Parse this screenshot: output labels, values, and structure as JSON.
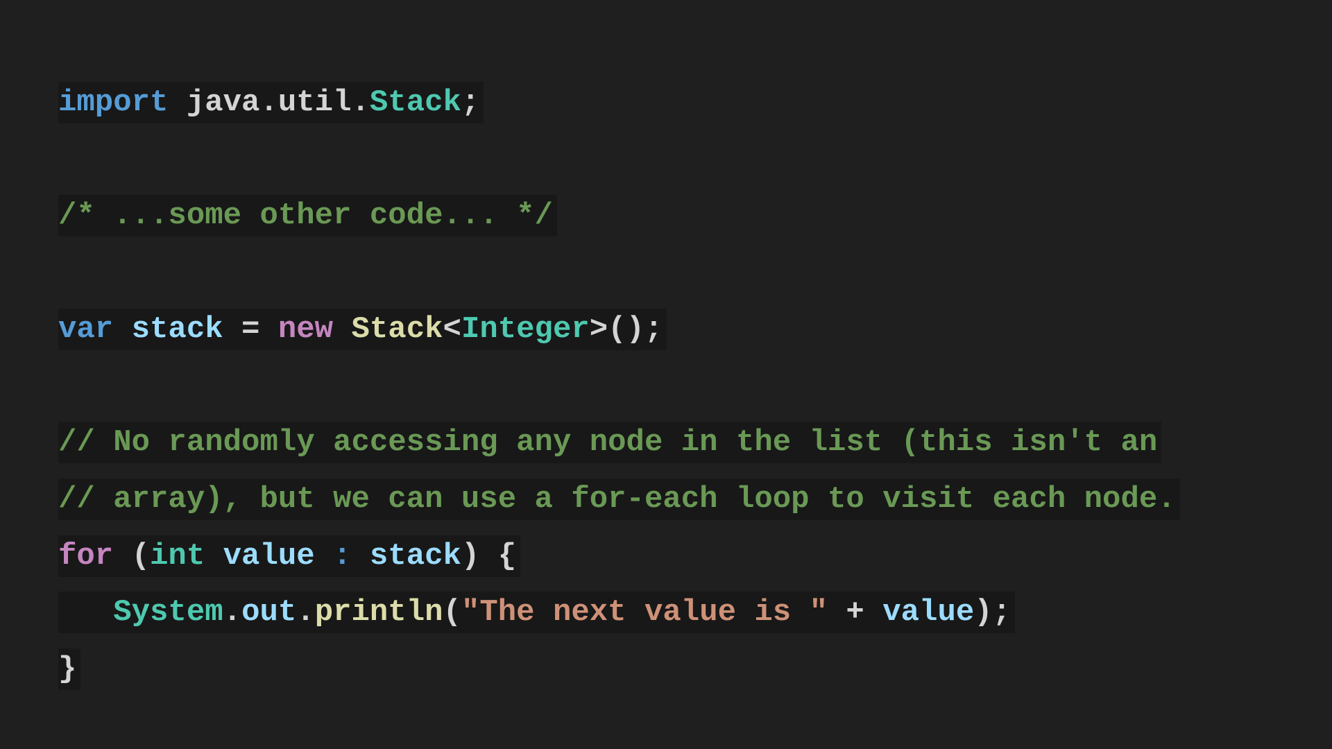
{
  "theme": {
    "background": "#1f1f1f",
    "line_highlight": "#181818",
    "keyword_blue": "#569cd6",
    "keyword_purple": "#c586c0",
    "type_teal": "#4ec9b0",
    "variable_lightblue": "#9cdcfe",
    "function_yellow": "#dcdcaa",
    "string_orange": "#ce9178",
    "comment_green": "#6a9955",
    "default_text": "#d4d4d4"
  },
  "code": {
    "language": "java",
    "lines": [
      {
        "tokens": [
          {
            "text": "import",
            "color": "#569cd6"
          },
          {
            "text": " java.util.",
            "color": "#d4d4d4"
          },
          {
            "text": "Stack",
            "color": "#4ec9b0"
          },
          {
            "text": ";",
            "color": "#d4d4d4"
          }
        ]
      },
      {
        "tokens": []
      },
      {
        "tokens": [
          {
            "text": "/* ...some other code... */",
            "color": "#6a9955"
          }
        ]
      },
      {
        "tokens": []
      },
      {
        "tokens": [
          {
            "text": "var",
            "color": "#569cd6"
          },
          {
            "text": " ",
            "color": "#d4d4d4"
          },
          {
            "text": "stack",
            "color": "#9cdcfe"
          },
          {
            "text": " = ",
            "color": "#d4d4d4"
          },
          {
            "text": "new",
            "color": "#c586c0"
          },
          {
            "text": " ",
            "color": "#d4d4d4"
          },
          {
            "text": "Stack",
            "color": "#dcdcaa"
          },
          {
            "text": "<",
            "color": "#d4d4d4"
          },
          {
            "text": "Integer",
            "color": "#4ec9b0"
          },
          {
            "text": ">();",
            "color": "#d4d4d4"
          }
        ]
      },
      {
        "tokens": []
      },
      {
        "tokens": [
          {
            "text": "// No randomly accessing any node in the list (this isn't an",
            "color": "#6a9955"
          }
        ]
      },
      {
        "tokens": [
          {
            "text": "// array), but we can use a for-each loop to visit each node.",
            "color": "#6a9955"
          }
        ]
      },
      {
        "tokens": [
          {
            "text": "for",
            "color": "#c586c0"
          },
          {
            "text": " (",
            "color": "#d4d4d4"
          },
          {
            "text": "int",
            "color": "#4ec9b0"
          },
          {
            "text": " ",
            "color": "#d4d4d4"
          },
          {
            "text": "value",
            "color": "#9cdcfe"
          },
          {
            "text": " : ",
            "color": "#569cd6"
          },
          {
            "text": "stack",
            "color": "#9cdcfe"
          },
          {
            "text": ") {",
            "color": "#d4d4d4"
          }
        ]
      },
      {
        "tokens": [
          {
            "text": "   ",
            "color": "#d4d4d4"
          },
          {
            "text": "System",
            "color": "#4ec9b0"
          },
          {
            "text": ".",
            "color": "#d4d4d4"
          },
          {
            "text": "out",
            "color": "#9cdcfe"
          },
          {
            "text": ".",
            "color": "#d4d4d4"
          },
          {
            "text": "println",
            "color": "#dcdcaa"
          },
          {
            "text": "(",
            "color": "#d4d4d4"
          },
          {
            "text": "\"The next value is \"",
            "color": "#ce9178"
          },
          {
            "text": " + ",
            "color": "#d4d4d4"
          },
          {
            "text": "value",
            "color": "#9cdcfe"
          },
          {
            "text": ");",
            "color": "#d4d4d4"
          }
        ]
      },
      {
        "tokens": [
          {
            "text": "}",
            "color": "#d4d4d4"
          }
        ]
      }
    ]
  }
}
